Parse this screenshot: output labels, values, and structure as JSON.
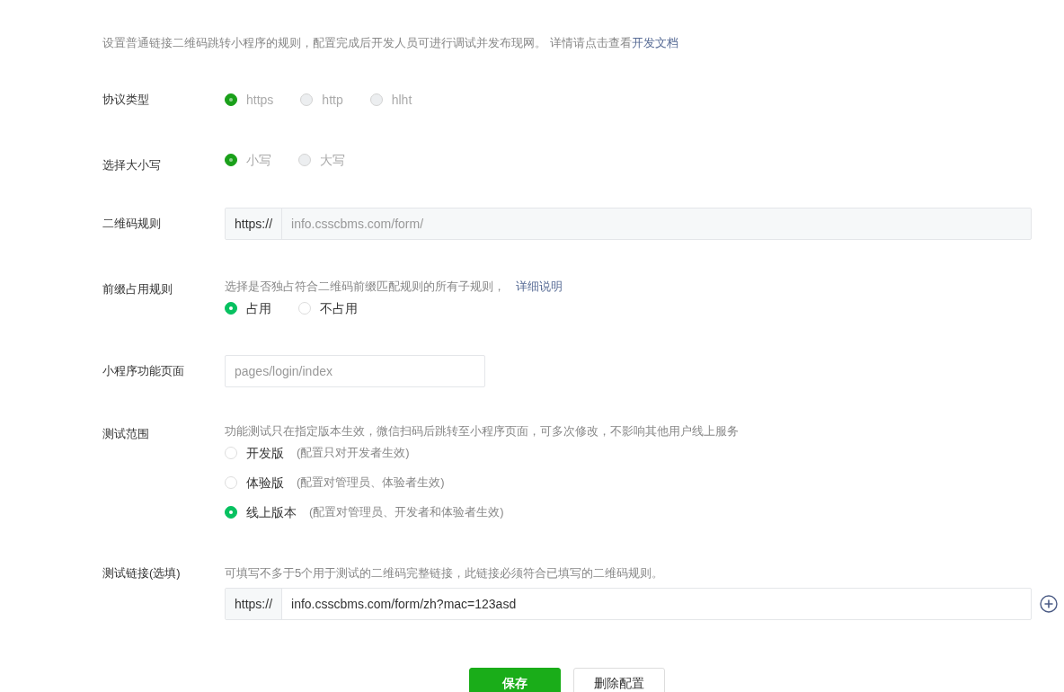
{
  "intro": {
    "text": "设置普通链接二维码跳转小程序的规则，配置完成后开发人员可进行调试并发布现网。 详情请点击查看",
    "link": "开发文档"
  },
  "rows": [
    {
      "kind": "radio",
      "label": "协议类型",
      "disabled": true,
      "options": [
        {
          "label": "https",
          "selected": true
        },
        {
          "label": "http",
          "selected": false
        },
        {
          "label": "hlht",
          "selected": false
        }
      ]
    },
    {
      "kind": "radio",
      "label": "选择大小写",
      "disabled": true,
      "options": [
        {
          "label": "小写",
          "selected": true
        },
        {
          "label": "大写",
          "selected": false
        }
      ]
    },
    {
      "kind": "prefix_input",
      "label": "二维码规则",
      "prefix": "https://",
      "placeholder": "info.csscbms.com/form/"
    },
    {
      "kind": "radio",
      "label": "前缀占用规则",
      "hint": "选择是否独占符合二维码前缀匹配规则的所有子规则，",
      "hint_link": "详细说明",
      "disabled": false,
      "options": [
        {
          "label": "占用",
          "selected": true
        },
        {
          "label": "不占用",
          "selected": false
        }
      ]
    },
    {
      "kind": "input",
      "label": "小程序功能页面",
      "placeholder": "pages/login/index"
    },
    {
      "kind": "radio_list",
      "label": "测试范围",
      "hint": "功能测试只在指定版本生效，微信扫码后跳转至小程序页面，可多次修改，不影响其他用户线上服务",
      "disabled": false,
      "options": [
        {
          "label": "开发版",
          "note": "(配置只对开发者生效)",
          "selected": false
        },
        {
          "label": "体验版",
          "note": "(配置对管理员、体验者生效)",
          "selected": false
        },
        {
          "label": "线上版本",
          "note": "(配置对管理员、开发者和体验者生效)",
          "selected": true
        }
      ]
    },
    {
      "kind": "prefix_input",
      "label": "测试链接(选填)",
      "hint": "可填写不多于5个用于测试的二维码完整链接，此链接必须符合已填写的二维码规则。",
      "prefix": "https://",
      "value": "info.csscbms.com/form/zh?mac=123asd",
      "add_button": true
    }
  ],
  "buttons": [
    {
      "label": "保存",
      "kind": "primary"
    },
    {
      "label": "删除配置",
      "kind": "default"
    }
  ]
}
